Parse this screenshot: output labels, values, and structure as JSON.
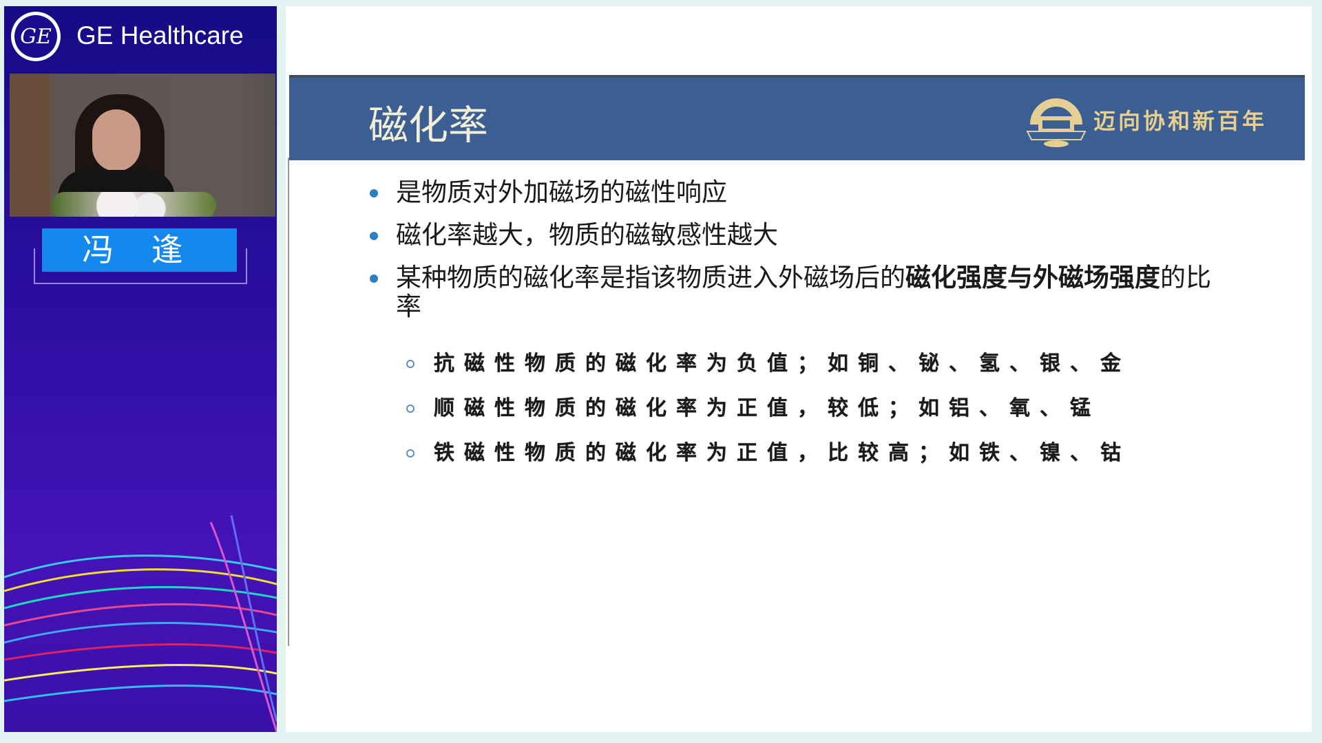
{
  "sidebar": {
    "brand": "GE Healthcare",
    "logo_text": "GE",
    "speaker_name": "冯 逢"
  },
  "slide": {
    "title": "磁化率",
    "motto": "迈向协和新百年",
    "bullets": [
      {
        "text": "是物质对外加磁场的磁性响应"
      },
      {
        "text": "磁化率越大，物质的磁敏感性越大"
      },
      {
        "text_before": "某种物质的磁化率是指该物质进入外磁场后的",
        "text_bold": "磁化强度与外磁场强度",
        "text_after": "的比率"
      }
    ],
    "sub_bullets": [
      "抗磁性物质的磁化率为负值；如铜、铋、氢、银、金",
      "顺磁性物质的磁化率为正值，较低；如铝、氧、锰",
      "铁磁性物质的磁化率为正值，比较高；如铁、镍、钴"
    ]
  },
  "colors": {
    "header": "#3b5f93",
    "title": "#f3eed8",
    "motto": "#e9cf8e",
    "bullet": "#2e7fc0",
    "name_box": "#1488ec",
    "sidebar": "#2a0ea0"
  }
}
